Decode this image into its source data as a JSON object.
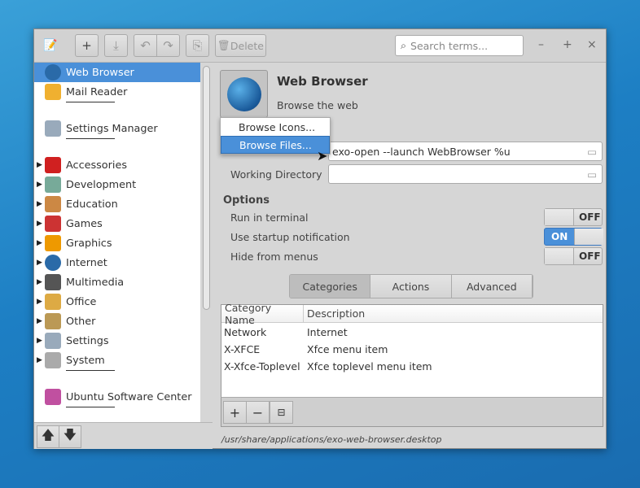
{
  "toolbar": {
    "delete_label": "Delete",
    "search_placeholder": "Search terms..."
  },
  "sidebar": {
    "items": [
      {
        "label": "Web Browser",
        "icon": "globe-icon",
        "color": "#2a6aa8",
        "selected": true
      },
      {
        "label": "Mail Reader",
        "icon": "mail-icon",
        "color": "#f0b030"
      },
      {
        "label": "Settings Manager",
        "icon": "settings-manager-icon",
        "color": "#9ab"
      },
      {
        "label": "Accessories",
        "icon": "accessories-icon",
        "color": "#d02020",
        "expandable": true
      },
      {
        "label": "Development",
        "icon": "development-icon",
        "color": "#7a9"
      },
      {
        "label": "Education",
        "icon": "education-icon",
        "color": "#c84"
      },
      {
        "label": "Games",
        "icon": "games-icon",
        "color": "#c33"
      },
      {
        "label": "Graphics",
        "icon": "graphics-icon",
        "color": "#e90"
      },
      {
        "label": "Internet",
        "icon": "globe-icon",
        "color": "#2a6aa8"
      },
      {
        "label": "Multimedia",
        "icon": "multimedia-icon",
        "color": "#555"
      },
      {
        "label": "Office",
        "icon": "office-icon",
        "color": "#da4"
      },
      {
        "label": "Other",
        "icon": "other-icon",
        "color": "#b95"
      },
      {
        "label": "Settings",
        "icon": "settings-icon",
        "color": "#9ab"
      },
      {
        "label": "System",
        "icon": "system-icon",
        "color": "#aaa"
      },
      {
        "label": "Ubuntu Software Center",
        "icon": "software-center-icon",
        "color": "#c050a0"
      }
    ]
  },
  "launcher": {
    "name": "Web Browser",
    "comment": "Browse the web",
    "command": "exo-open --launch WebBrowser %u",
    "working_directory_label": "Working Directory",
    "working_directory": ""
  },
  "icon_menu": {
    "items": [
      "Browse Icons...",
      "Browse Files..."
    ],
    "highlighted": 1
  },
  "options": {
    "title": "Options",
    "items": [
      {
        "label": "Run in terminal",
        "state": "OFF"
      },
      {
        "label": "Use startup notification",
        "state": "ON"
      },
      {
        "label": "Hide from menus",
        "state": "OFF"
      }
    ]
  },
  "tabs": [
    "Categories",
    "Actions",
    "Advanced"
  ],
  "active_tab": 0,
  "categories": {
    "headers": [
      "Category Name",
      "Description"
    ],
    "rows": [
      [
        "Network",
        "Internet"
      ],
      [
        "X-XFCE",
        "Xfce menu item"
      ],
      [
        "X-Xfce-Toplevel",
        "Xfce toplevel menu item"
      ]
    ]
  },
  "status_path": "/usr/share/applications/exo-web-browser.desktop",
  "colors": {
    "accent": "#4a90d9"
  }
}
